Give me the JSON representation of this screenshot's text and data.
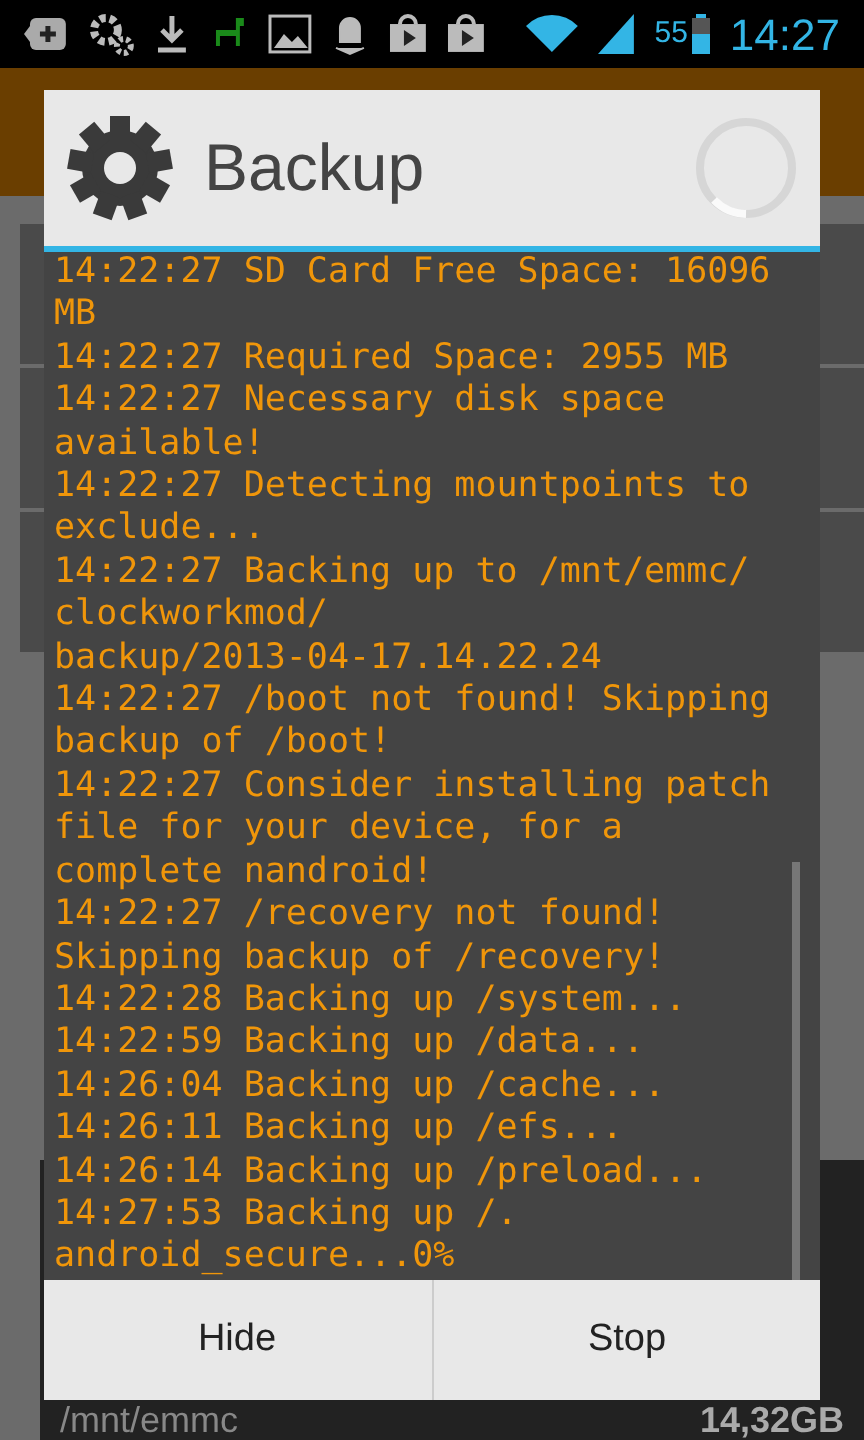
{
  "status_bar": {
    "battery": "55",
    "time": "14:27"
  },
  "background_list": {
    "path": "/mnt/emmc",
    "size": "14,32GB"
  },
  "dialog": {
    "title": "Backup",
    "log_lines": [
      "14:22:27 SD Card Free Space: 16096",
      "MB",
      "14:22:27 Required Space: 2955 MB",
      "14:22:27 Necessary disk space",
      "available!",
      "14:22:27 Detecting mountpoints to",
      "exclude...",
      "14:22:27 Backing up to /mnt/emmc/",
      "clockworkmod/",
      "backup/2013-04-17.14.22.24",
      "14:22:27 /boot not found! Skipping",
      "backup of /boot!",
      "14:22:27 Consider installing patch",
      "file for your device, for a",
      "complete nandroid!",
      "14:22:27 /recovery not found!",
      "Skipping backup of /recovery!",
      "14:22:28 Backing up /system...",
      "14:22:59 Backing up /data...",
      "14:26:04 Backing up /cache...",
      "14:26:11 Backing up /efs...",
      "14:26:14 Backing up /preload...",
      "14:27:53 Backing up /.",
      "android_secure...0%"
    ],
    "buttons": [
      "Hide",
      "Stop"
    ]
  }
}
